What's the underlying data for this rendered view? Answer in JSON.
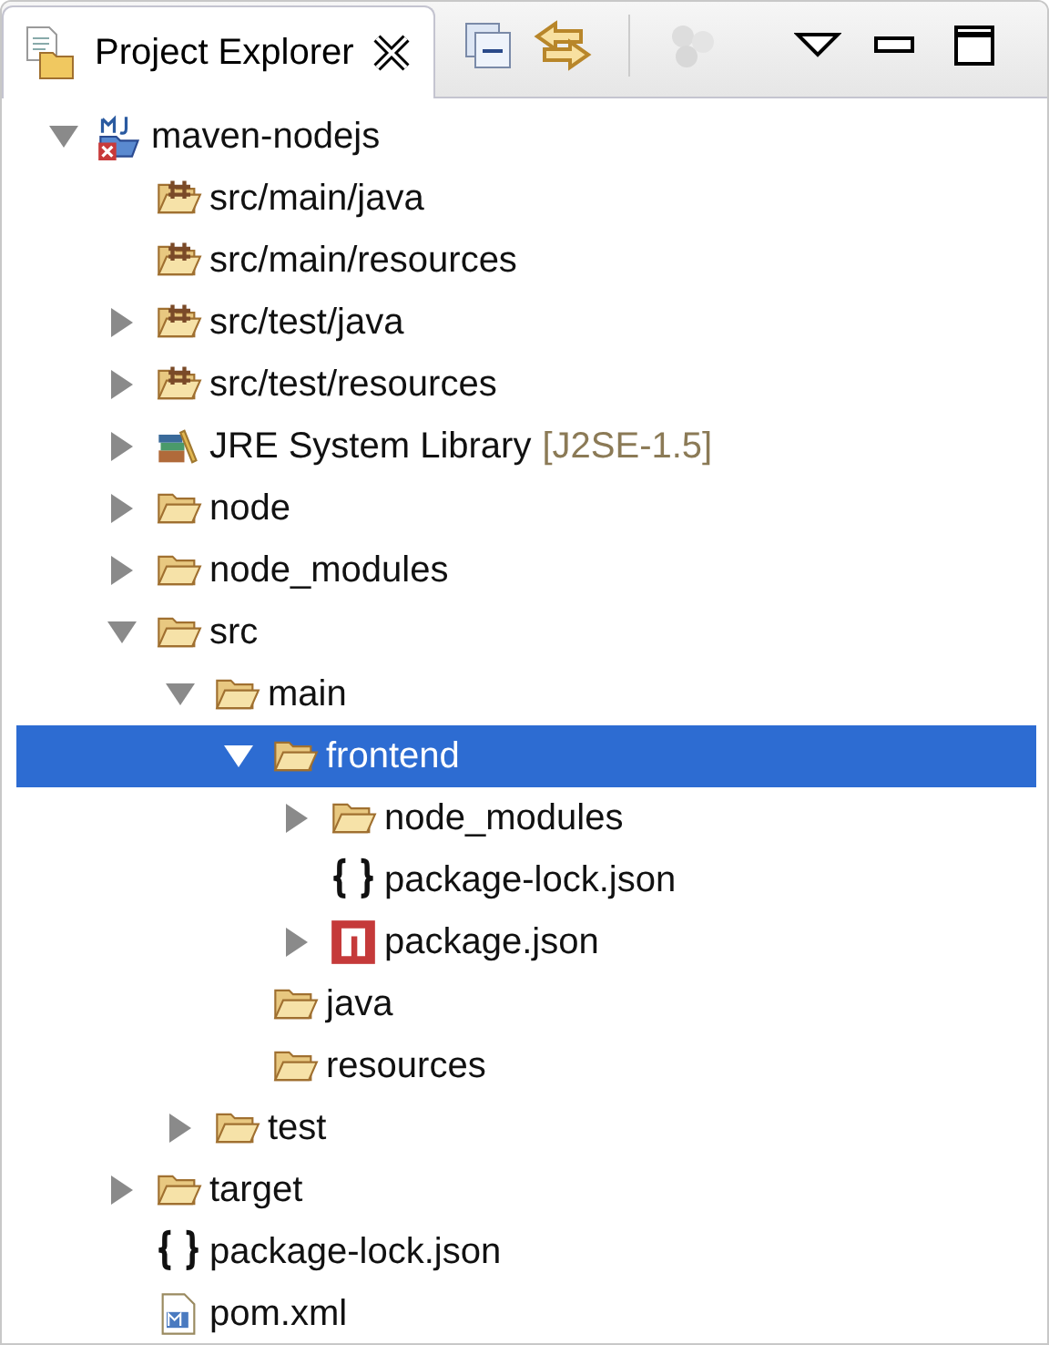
{
  "view": {
    "tab": {
      "title": "Project Explorer",
      "selected": true
    }
  },
  "tree": [
    {
      "label": "maven-nodejs",
      "kind": "project",
      "expanded": true,
      "selected": false,
      "children": [
        {
          "label": "src/main/java",
          "kind": "package",
          "selected": false
        },
        {
          "label": "src/main/resources",
          "kind": "package",
          "selected": false
        },
        {
          "label": "src/test/java",
          "kind": "package",
          "expanded": false,
          "selected": false
        },
        {
          "label": "src/test/resources",
          "kind": "package",
          "expanded": false,
          "selected": false
        },
        {
          "label": "JRE System Library",
          "decoration": "[J2SE-1.5]",
          "kind": "library",
          "expanded": false,
          "selected": false
        },
        {
          "label": "node",
          "kind": "folder",
          "expanded": false,
          "selected": false
        },
        {
          "label": "node_modules",
          "kind": "folder",
          "expanded": false,
          "selected": false
        },
        {
          "label": "src",
          "kind": "folder",
          "expanded": true,
          "selected": false,
          "children": [
            {
              "label": "main",
              "kind": "folder",
              "expanded": true,
              "selected": false,
              "children": [
                {
                  "label": "frontend",
                  "kind": "folder",
                  "expanded": true,
                  "selected": true,
                  "children": [
                    {
                      "label": "node_modules",
                      "kind": "folder",
                      "expanded": false,
                      "selected": false
                    },
                    {
                      "label": "package-lock.json",
                      "kind": "json",
                      "selected": false
                    },
                    {
                      "label": "package.json",
                      "kind": "npm",
                      "expanded": false,
                      "selected": false
                    }
                  ]
                },
                {
                  "label": "java",
                  "kind": "folder",
                  "selected": false
                },
                {
                  "label": "resources",
                  "kind": "folder",
                  "selected": false
                }
              ]
            },
            {
              "label": "test",
              "kind": "folder",
              "expanded": false,
              "selected": false
            }
          ]
        },
        {
          "label": "target",
          "kind": "folder",
          "expanded": false,
          "selected": false
        },
        {
          "label": "package-lock.json",
          "kind": "json",
          "selected": false
        },
        {
          "label": "pom.xml",
          "kind": "maven",
          "selected": false
        }
      ]
    }
  ]
}
